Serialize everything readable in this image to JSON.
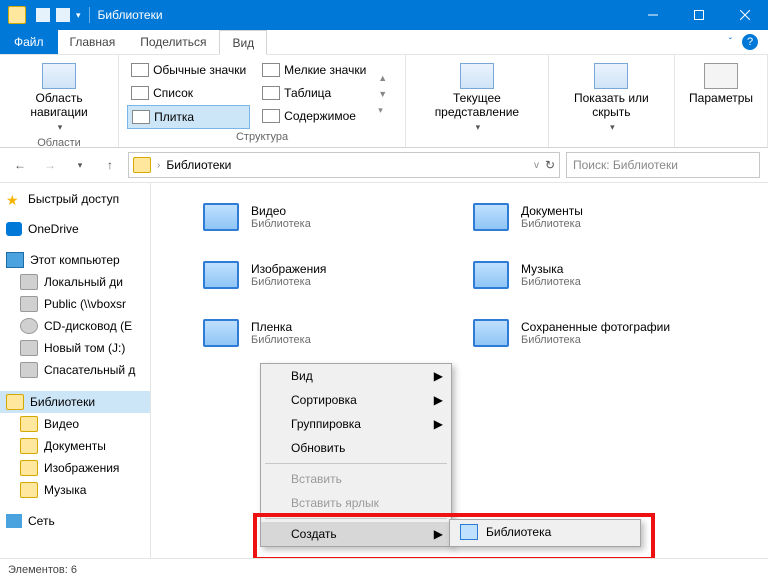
{
  "titlebar": {
    "title": "Библиотеки"
  },
  "menu": {
    "file": "Файл",
    "tabs": [
      "Главная",
      "Поделиться",
      "Вид"
    ],
    "active": 2
  },
  "ribbon": {
    "nav_pane": "Область навигации",
    "group_area": "Области",
    "icons_regular": "Обычные значки",
    "icons_small": "Мелкие значки",
    "list": "Список",
    "table": "Таблица",
    "tiles": "Плитка",
    "content": "Содержимое",
    "group_layout": "Структура",
    "current_view": "Текущее представление",
    "show_hide": "Показать или скрыть",
    "options": "Параметры"
  },
  "address": {
    "path": "Библиотеки"
  },
  "search": {
    "placeholder": "Поиск: Библиотеки"
  },
  "tree": {
    "quick": "Быстрый доступ",
    "onedrive": "OneDrive",
    "pc": "Этот компьютер",
    "local": "Локальный ди",
    "public": "Public (\\\\vboxsr",
    "cd": "CD-дисковод (E",
    "newvol": "Новый том (J:)",
    "rescue": "Спасательный д",
    "libraries": "Библиотеки",
    "video": "Видео",
    "documents": "Документы",
    "images": "Изображения",
    "music": "Музыка",
    "network": "Сеть"
  },
  "libs": [
    {
      "name": "Видео",
      "sub": "Библиотека"
    },
    {
      "name": "Документы",
      "sub": "Библиотека"
    },
    {
      "name": "Изображения",
      "sub": "Библиотека"
    },
    {
      "name": "Музыка",
      "sub": "Библиотека"
    },
    {
      "name": "Пленка",
      "sub": "Библиотека"
    },
    {
      "name": "Сохраненные фотографии",
      "sub": "Библиотека"
    }
  ],
  "ctx": {
    "view": "Вид",
    "sort": "Сортировка",
    "group": "Группировка",
    "refresh": "Обновить",
    "paste": "Вставить",
    "paste_shortcut": "Вставить ярлык",
    "create": "Создать",
    "sub_library": "Библиотека"
  },
  "status": {
    "text": "Элементов: 6"
  }
}
